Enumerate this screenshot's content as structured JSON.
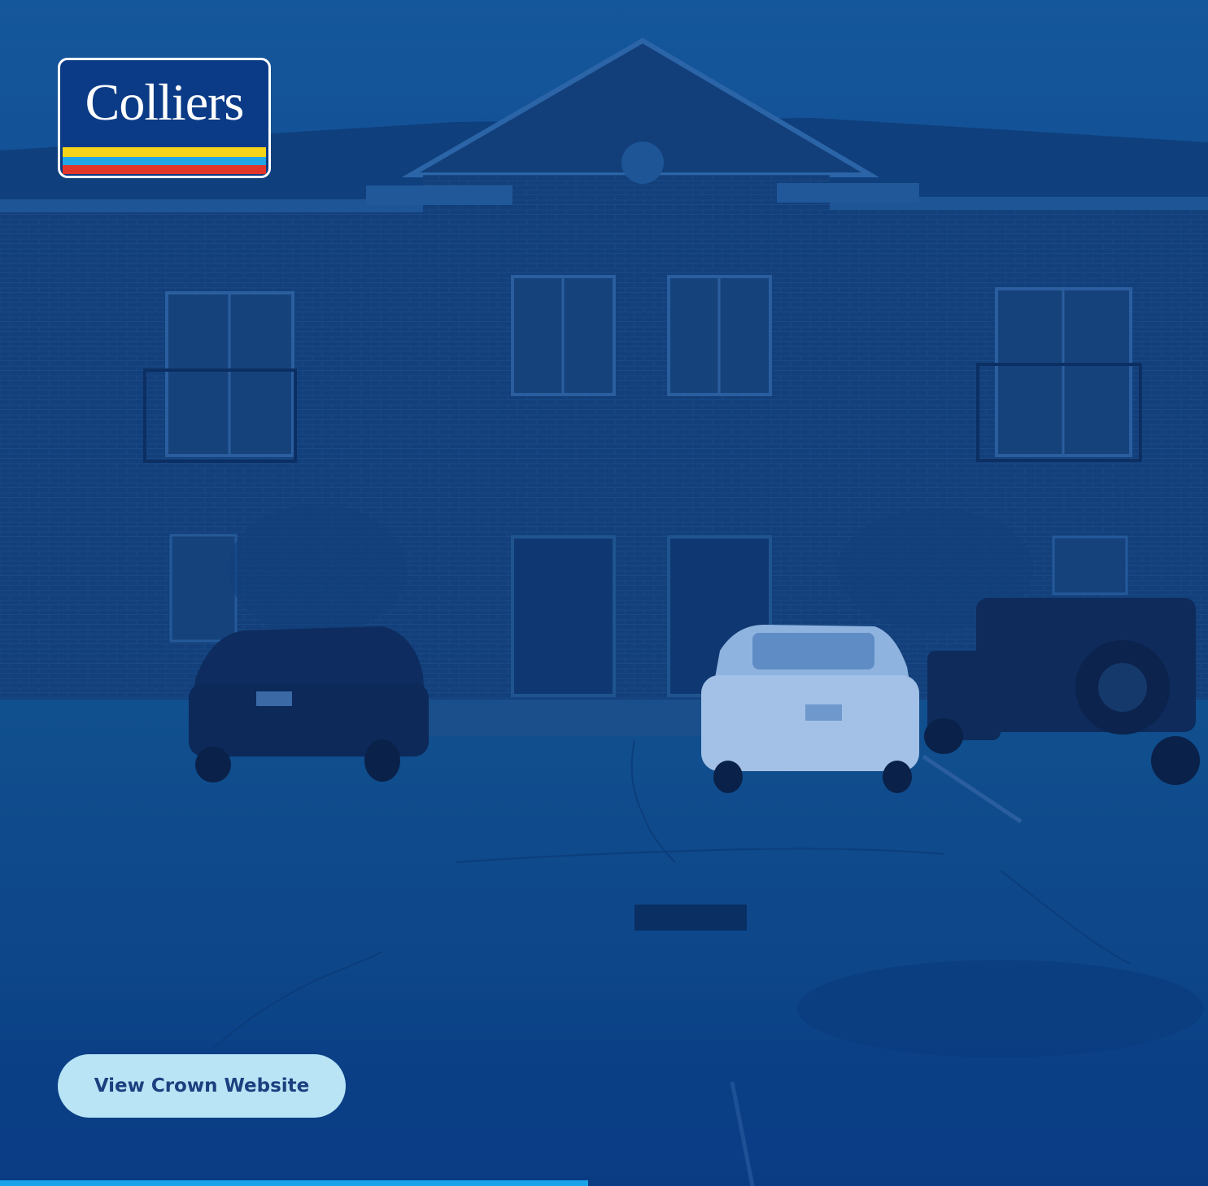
{
  "brand": {
    "logo_text": "Colliers",
    "logo_colors": {
      "background": "#0b3b86",
      "stripe_yellow": "#f7d418",
      "stripe_blue": "#20a5e6",
      "stripe_red": "#e3362a"
    }
  },
  "hero": {
    "image_icon": "building-photo",
    "overlay_color": "#0d4a8f"
  },
  "cta": {
    "label": "View Crown Website",
    "background": "#b8e4f5",
    "text_color": "#1b3f7f"
  },
  "progress": {
    "fraction": 0.487,
    "color": "#1aa3e8"
  }
}
